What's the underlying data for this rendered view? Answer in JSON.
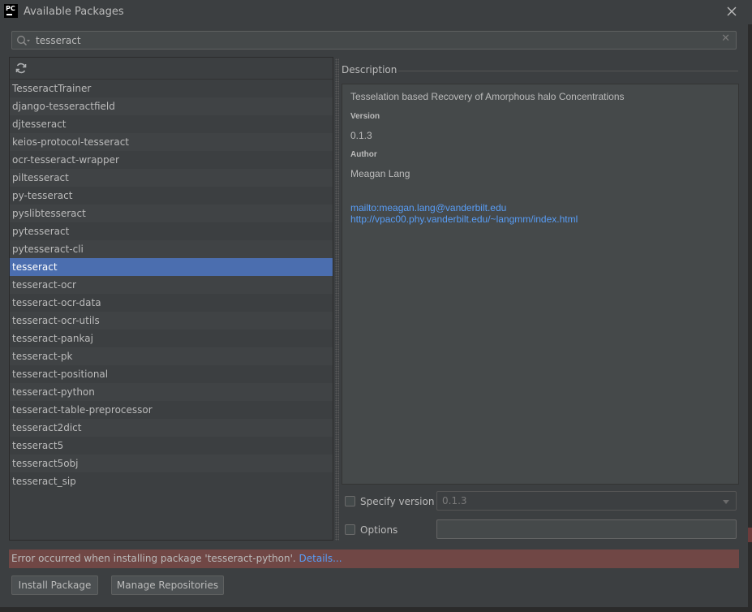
{
  "window": {
    "title": "Available Packages",
    "logo_text": "PC"
  },
  "search": {
    "value": "tesseract"
  },
  "packages": [
    "TesseractTrainer",
    "django-tesseractfield",
    "djtesseract",
    "keios-protocol-tesseract",
    "ocr-tesseract-wrapper",
    "piltesseract",
    "py-tesseract",
    "pyslibtesseract",
    "pytesseract",
    "pytesseract-cli",
    "tesseract",
    "tesseract-ocr",
    "tesseract-ocr-data",
    "tesseract-ocr-utils",
    "tesseract-pankaj",
    "tesseract-pk",
    "tesseract-positional",
    "tesseract-python",
    "tesseract-table-preprocessor",
    "tesseract2dict",
    "tesseract5",
    "tesseract5obj",
    "tesseract_sip"
  ],
  "selected_package": "tesseract",
  "description": {
    "section_label": "Description",
    "summary": "Tesselation based Recovery of Amorphous halo Concentrations",
    "version_heading": "Version",
    "version": "0.1.3",
    "author_heading": "Author",
    "author": "Meagan Lang",
    "email_link": "mailto:meagan.lang@vanderbilt.edu",
    "homepage_link": "http://vpac00.phy.vanderbilt.edu/~langmm/index.html"
  },
  "options": {
    "specify_version_label": "Specify version",
    "specify_version_checked": false,
    "version_value": "0.1.3",
    "options_label": "Options",
    "options_checked": false,
    "options_value": ""
  },
  "error": {
    "message": "Error occurred when installing package 'tesseract-python'.",
    "details_link": "Details..."
  },
  "buttons": {
    "install": "Install Package",
    "manage": "Manage Repositories"
  },
  "colors": {
    "background": "#3c3f41",
    "selection": "#4b6eaf",
    "link": "#589df6",
    "error_background": "#704745"
  },
  "icons": {
    "logo": "pycharm-logo-icon",
    "close": "close-icon",
    "search": "search-icon",
    "clear": "clear-search-icon",
    "refresh": "refresh-icon",
    "dropdown": "chevron-down-icon"
  }
}
